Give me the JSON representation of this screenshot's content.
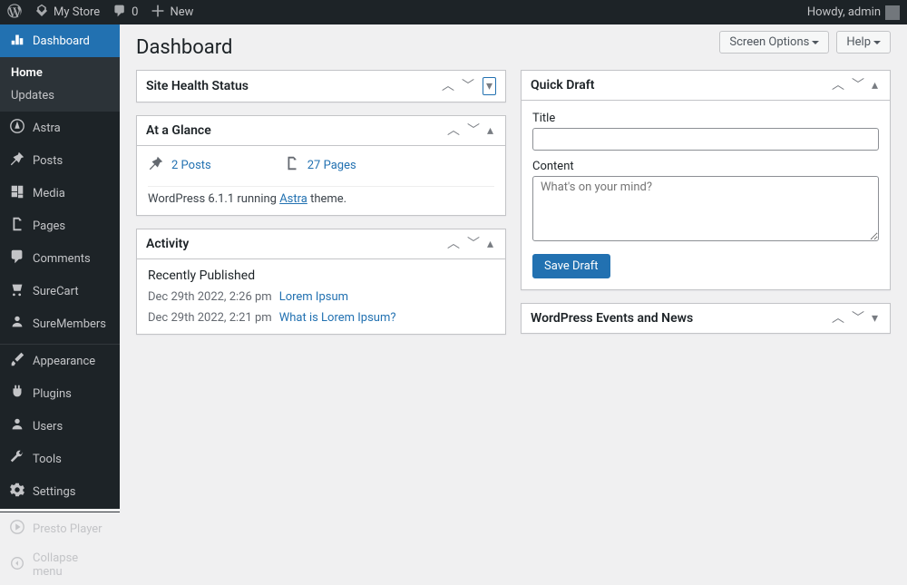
{
  "adminbar": {
    "site_name": "My Store",
    "comments_count": "0",
    "new_label": "New",
    "howdy": "Howdy, admin"
  },
  "sidebar": {
    "dashboard": "Dashboard",
    "submenu": {
      "home": "Home",
      "updates": "Updates"
    },
    "items": [
      {
        "key": "astra",
        "label": "Astra"
      },
      {
        "key": "posts",
        "label": "Posts"
      },
      {
        "key": "media",
        "label": "Media"
      },
      {
        "key": "pages",
        "label": "Pages"
      },
      {
        "key": "comments",
        "label": "Comments"
      },
      {
        "key": "surecart",
        "label": "SureCart"
      },
      {
        "key": "suremembers",
        "label": "SureMembers"
      },
      {
        "key": "appearance",
        "label": "Appearance"
      },
      {
        "key": "plugins",
        "label": "Plugins"
      },
      {
        "key": "users",
        "label": "Users"
      },
      {
        "key": "tools",
        "label": "Tools"
      },
      {
        "key": "settings",
        "label": "Settings"
      },
      {
        "key": "presto",
        "label": "Presto Player"
      }
    ],
    "collapse": "Collapse menu"
  },
  "top": {
    "title": "Dashboard",
    "screen_options": "Screen Options",
    "help": "Help"
  },
  "boxes": {
    "site_health": {
      "title": "Site Health Status"
    },
    "glance": {
      "title": "At a Glance",
      "posts": "2 Posts",
      "pages": "27 Pages",
      "wp_prefix": "WordPress 6.1.1 running ",
      "theme": "Astra",
      "wp_suffix": " theme."
    },
    "activity": {
      "title": "Activity",
      "recent": "Recently Published",
      "rows": [
        {
          "date": "Dec 29th 2022, 2:26 pm",
          "link": "Lorem Ipsum"
        },
        {
          "date": "Dec 29th 2022, 2:21 pm",
          "link": "What is Lorem Ipsum?"
        }
      ]
    },
    "quick_draft": {
      "title": "Quick Draft",
      "title_label": "Title",
      "content_label": "Content",
      "placeholder": "What's on your mind?",
      "save": "Save Draft"
    },
    "events": {
      "title": "WordPress Events and News"
    }
  }
}
